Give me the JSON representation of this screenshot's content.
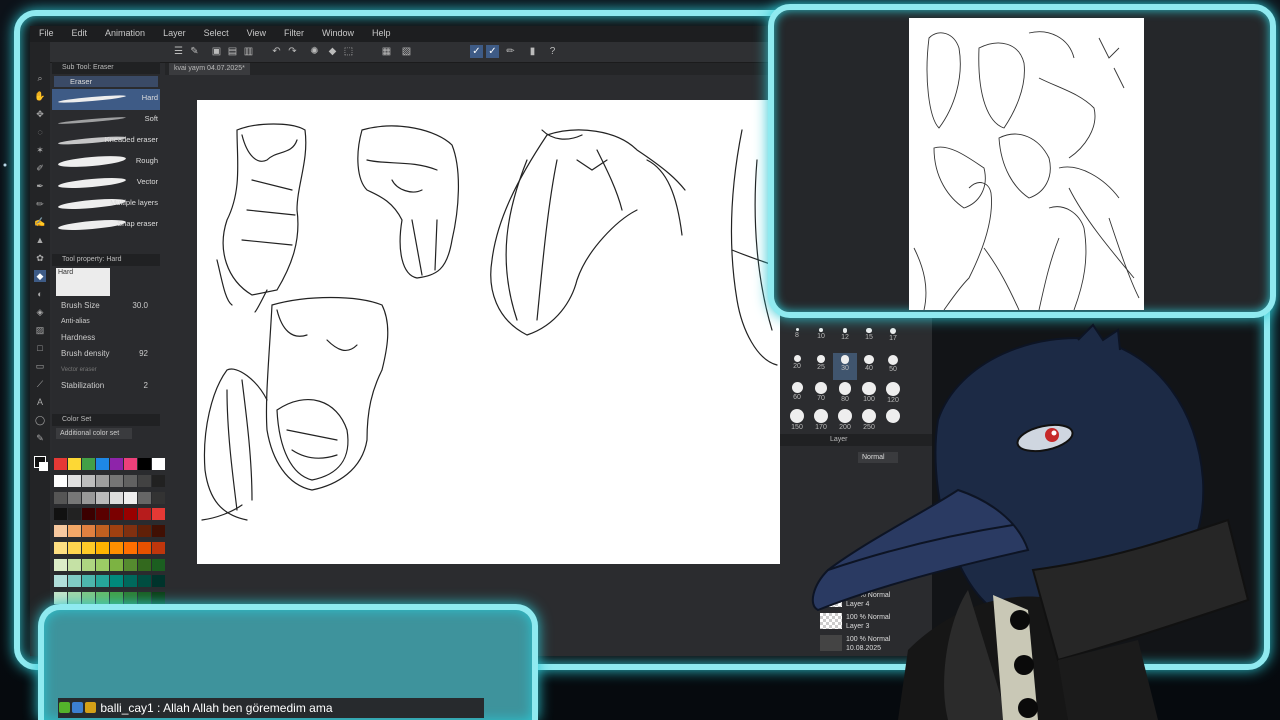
{
  "menu": [
    "File",
    "Edit",
    "Animation",
    "Layer",
    "Select",
    "View",
    "Filter",
    "Window",
    "Help"
  ],
  "doc_tab": "kvai yaym 04.07.2025*",
  "subtool": {
    "header": "Sub Tool: Eraser",
    "group": "Eraser",
    "brushes": [
      "Hard",
      "Soft",
      "Kneaded eraser",
      "Rough",
      "Vector",
      "Multiple layers",
      "Snap eraser"
    ]
  },
  "tool_property": {
    "header": "Tool property: Hard",
    "preview_label": "Hard",
    "brush_size_label": "Brush Size",
    "brush_size_value": "30.0",
    "anti_alias_label": "Anti-alias",
    "hardness_label": "Hardness",
    "brush_density_label": "Brush density",
    "brush_density_value": "92",
    "vector_label": "Vector eraser",
    "stabilization_label": "Stabilization",
    "stabilization_value": "2"
  },
  "color_set": {
    "header": "Color Set",
    "selected": "Additional color set"
  },
  "brush_sizes": [
    "8",
    "10",
    "12",
    "15",
    "17",
    "20",
    "25",
    "30",
    "40",
    "50",
    "60",
    "70",
    "80",
    "100",
    "120",
    "150",
    "170",
    "200",
    "250",
    ""
  ],
  "layer_panel": {
    "header": "Layer",
    "blend": "Normal",
    "layers": [
      {
        "opacity": "100 % Normal",
        "name": "Layer 4"
      },
      {
        "opacity": "100 % Normal",
        "name": "Layer 3"
      },
      {
        "opacity": "100 % Normal",
        "name": "10.08.2025"
      }
    ]
  },
  "chat": {
    "user": "balli_cay1",
    "separator": " : ",
    "message": "Allah Allah ben göremedim ama"
  }
}
